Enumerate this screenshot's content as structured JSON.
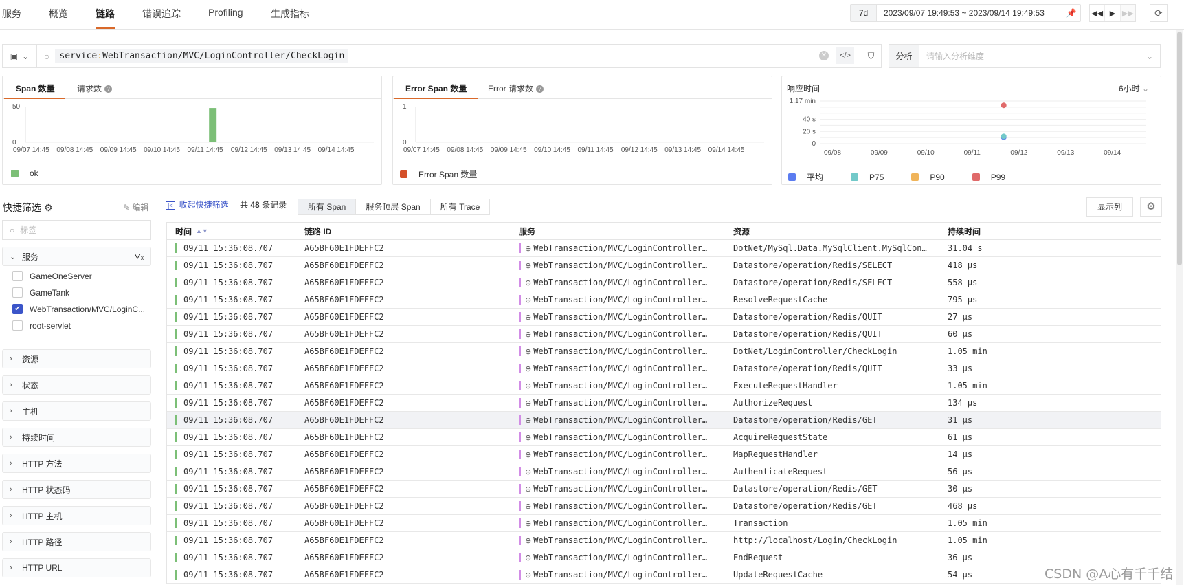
{
  "nav": {
    "tabs": [
      {
        "label": "服务",
        "active": false
      },
      {
        "label": "概览",
        "active": false
      },
      {
        "label": "链路",
        "active": true
      },
      {
        "label": "错误追踪",
        "active": false
      },
      {
        "label": "Profiling",
        "active": false
      },
      {
        "label": "生成指标",
        "active": false
      }
    ],
    "time_badge": "7d",
    "time_range": "2023/09/07 19:49:53 ~ 2023/09/14 19:49:53"
  },
  "search": {
    "query_key": "service",
    "query_value": "WebTransaction/MVC/LoginController/CheckLogin",
    "analysis_label": "分析",
    "analysis_placeholder": "请输入分析维度"
  },
  "cards": {
    "span": {
      "tab1": "Span 数量",
      "tab2": "请求数",
      "legend": "ok"
    },
    "error": {
      "tab1": "Error Span 数量",
      "tab2": "Error 请求数",
      "legend": "Error Span 数量"
    },
    "latency": {
      "title": "响应时间",
      "interval": "6小时"
    }
  },
  "chart_data": [
    {
      "type": "bar",
      "title": "Span 数量",
      "categories": [
        "09/07 14:45",
        "09/08 14:45",
        "09/09 14:45",
        "09/10 14:45",
        "09/11 14:45",
        "09/12 14:45",
        "09/13 14:45",
        "09/14 14:45"
      ],
      "series": [
        {
          "name": "ok",
          "color": "#7cbf77",
          "points": [
            {
              "x": 4.0,
              "value": 48
            }
          ]
        }
      ],
      "yticks": [
        "0",
        "50"
      ],
      "ylim": [
        0,
        50
      ]
    },
    {
      "type": "bar",
      "title": "Error Span 数量",
      "categories": [
        "09/07 14:45",
        "09/08 14:45",
        "09/09 14:45",
        "09/10 14:45",
        "09/11 14:45",
        "09/12 14:45",
        "09/13 14:45",
        "09/14 14:45"
      ],
      "series": [
        {
          "name": "Error Span 数量",
          "color": "#d4502a",
          "points": []
        }
      ],
      "yticks": [
        "0",
        "1"
      ],
      "ylim": [
        0,
        1
      ]
    },
    {
      "type": "scatter",
      "title": "响应时间",
      "categories": [
        "09/08",
        "09/09",
        "09/10",
        "09/11",
        "09/12",
        "09/13",
        "09/14"
      ],
      "yticks": [
        {
          "label": "0",
          "value": 0
        },
        {
          "label": "20 s",
          "value": 20
        },
        {
          "label": "40 s",
          "value": 40
        },
        {
          "label": "1.17 min",
          "value": 70
        }
      ],
      "ylim": [
        0,
        70
      ],
      "series": [
        {
          "name": "平均",
          "color": "#5b7cf0",
          "points": [
            {
              "x": 3.65,
              "value": 10.5
            }
          ]
        },
        {
          "name": "P75",
          "color": "#72c9c9",
          "points": [
            {
              "x": 3.65,
              "value": 12
            }
          ]
        },
        {
          "name": "P90",
          "color": "#f0b45a",
          "points": []
        },
        {
          "name": "P99",
          "color": "#e06a6a",
          "points": [
            {
              "x": 3.65,
              "value": 63
            }
          ]
        }
      ]
    }
  ],
  "sidebar": {
    "title": "快捷筛选",
    "edit": "编辑",
    "tag_placeholder": "标签",
    "service_group": "服务",
    "service_options": [
      {
        "label": "GameOneServer",
        "checked": false
      },
      {
        "label": "GameTank",
        "checked": false
      },
      {
        "label": "WebTransaction/MVC/LoginC...",
        "checked": true
      },
      {
        "label": "root-servlet",
        "checked": false
      }
    ],
    "groups": [
      "资源",
      "状态",
      "主机",
      "持续时间",
      "HTTP 方法",
      "HTTP 状态码",
      "HTTP 主机",
      "HTTP 路径",
      "HTTP URL"
    ]
  },
  "toolbar": {
    "collapse": "收起快捷筛选",
    "count_prefix": "共",
    "count": "48",
    "count_suffix": "条记录",
    "segments": [
      "所有 Span",
      "服务顶层 Span",
      "所有 Trace"
    ],
    "columns_btn": "显示列"
  },
  "table": {
    "headers": [
      "时间",
      "链路 ID",
      "服务",
      "资源",
      "持续时间"
    ],
    "rows": [
      {
        "time": "09/11 15:36:08.707",
        "trace_id": "A65BF60E1FDEFFC2",
        "service": "WebTransaction/MVC/LoginController…",
        "resource": "DotNet/MySql.Data.MySqlClient.MySqlCon…",
        "duration": "31.04 s"
      },
      {
        "time": "09/11 15:36:08.707",
        "trace_id": "A65BF60E1FDEFFC2",
        "service": "WebTransaction/MVC/LoginController…",
        "resource": "Datastore/operation/Redis/SELECT",
        "duration": "418 μs"
      },
      {
        "time": "09/11 15:36:08.707",
        "trace_id": "A65BF60E1FDEFFC2",
        "service": "WebTransaction/MVC/LoginController…",
        "resource": "Datastore/operation/Redis/SELECT",
        "duration": "558 μs"
      },
      {
        "time": "09/11 15:36:08.707",
        "trace_id": "A65BF60E1FDEFFC2",
        "service": "WebTransaction/MVC/LoginController…",
        "resource": "ResolveRequestCache",
        "duration": "795 μs"
      },
      {
        "time": "09/11 15:36:08.707",
        "trace_id": "A65BF60E1FDEFFC2",
        "service": "WebTransaction/MVC/LoginController…",
        "resource": "Datastore/operation/Redis/QUIT",
        "duration": "27 μs"
      },
      {
        "time": "09/11 15:36:08.707",
        "trace_id": "A65BF60E1FDEFFC2",
        "service": "WebTransaction/MVC/LoginController…",
        "resource": "Datastore/operation/Redis/QUIT",
        "duration": "60 μs"
      },
      {
        "time": "09/11 15:36:08.707",
        "trace_id": "A65BF60E1FDEFFC2",
        "service": "WebTransaction/MVC/LoginController…",
        "resource": "DotNet/LoginController/CheckLogin",
        "duration": "1.05 min"
      },
      {
        "time": "09/11 15:36:08.707",
        "trace_id": "A65BF60E1FDEFFC2",
        "service": "WebTransaction/MVC/LoginController…",
        "resource": "Datastore/operation/Redis/QUIT",
        "duration": "33 μs"
      },
      {
        "time": "09/11 15:36:08.707",
        "trace_id": "A65BF60E1FDEFFC2",
        "service": "WebTransaction/MVC/LoginController…",
        "resource": "ExecuteRequestHandler",
        "duration": "1.05 min"
      },
      {
        "time": "09/11 15:36:08.707",
        "trace_id": "A65BF60E1FDEFFC2",
        "service": "WebTransaction/MVC/LoginController…",
        "resource": "AuthorizeRequest",
        "duration": "134 μs"
      },
      {
        "time": "09/11 15:36:08.707",
        "trace_id": "A65BF60E1FDEFFC2",
        "service": "WebTransaction/MVC/LoginController…",
        "resource": "Datastore/operation/Redis/GET",
        "duration": "31 μs"
      },
      {
        "time": "09/11 15:36:08.707",
        "trace_id": "A65BF60E1FDEFFC2",
        "service": "WebTransaction/MVC/LoginController…",
        "resource": "AcquireRequestState",
        "duration": "61 μs"
      },
      {
        "time": "09/11 15:36:08.707",
        "trace_id": "A65BF60E1FDEFFC2",
        "service": "WebTransaction/MVC/LoginController…",
        "resource": "MapRequestHandler",
        "duration": "14 μs"
      },
      {
        "time": "09/11 15:36:08.707",
        "trace_id": "A65BF60E1FDEFFC2",
        "service": "WebTransaction/MVC/LoginController…",
        "resource": "AuthenticateRequest",
        "duration": "56 μs"
      },
      {
        "time": "09/11 15:36:08.707",
        "trace_id": "A65BF60E1FDEFFC2",
        "service": "WebTransaction/MVC/LoginController…",
        "resource": "Datastore/operation/Redis/GET",
        "duration": "30 μs"
      },
      {
        "time": "09/11 15:36:08.707",
        "trace_id": "A65BF60E1FDEFFC2",
        "service": "WebTransaction/MVC/LoginController…",
        "resource": "Datastore/operation/Redis/GET",
        "duration": "468 μs"
      },
      {
        "time": "09/11 15:36:08.707",
        "trace_id": "A65BF60E1FDEFFC2",
        "service": "WebTransaction/MVC/LoginController…",
        "resource": "Transaction",
        "duration": "1.05 min"
      },
      {
        "time": "09/11 15:36:08.707",
        "trace_id": "A65BF60E1FDEFFC2",
        "service": "WebTransaction/MVC/LoginController…",
        "resource": "http://localhost/Login/CheckLogin",
        "duration": "1.05 min"
      },
      {
        "time": "09/11 15:36:08.707",
        "trace_id": "A65BF60E1FDEFFC2",
        "service": "WebTransaction/MVC/LoginController…",
        "resource": "EndRequest",
        "duration": "36 μs"
      },
      {
        "time": "09/11 15:36:08.707",
        "trace_id": "A65BF60E1FDEFFC2",
        "service": "WebTransaction/MVC/LoginController…",
        "resource": "UpdateRequestCache",
        "duration": "54 μs"
      }
    ],
    "highlighted_row": 10
  },
  "watermark": "CSDN @A心有千千结"
}
